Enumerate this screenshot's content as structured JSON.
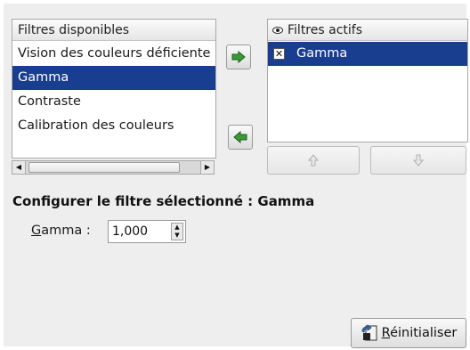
{
  "available_filters": {
    "header": "Filtres disponibles",
    "items": [
      {
        "label": "Vision des couleurs déficiente",
        "selected": false
      },
      {
        "label": "Gamma",
        "selected": true
      },
      {
        "label": "Contraste",
        "selected": false
      },
      {
        "label": "Calibration des couleurs",
        "selected": false
      }
    ]
  },
  "active_filters": {
    "header": "Filtres actifs",
    "items": [
      {
        "label": "Gamma",
        "enabled": true
      }
    ]
  },
  "buttons": {
    "add_icon": "arrow-right-icon",
    "remove_icon": "arrow-left-icon",
    "move_up_icon": "arrow-up-icon",
    "move_down_icon": "arrow-down-icon",
    "reset_label_first": "R",
    "reset_label_rest": "éinitialiser",
    "reset_icon": "reset-icon"
  },
  "configure": {
    "title": "Configurer le filtre sélectionné : Gamma",
    "gamma_label_mnemonic": "G",
    "gamma_label_rest": "amma :",
    "gamma_value": "1,000"
  },
  "colors": {
    "selection": "#1a3e8f",
    "dialog_bg": "#eeeeee",
    "arrow_green": "#2f8f2f"
  }
}
